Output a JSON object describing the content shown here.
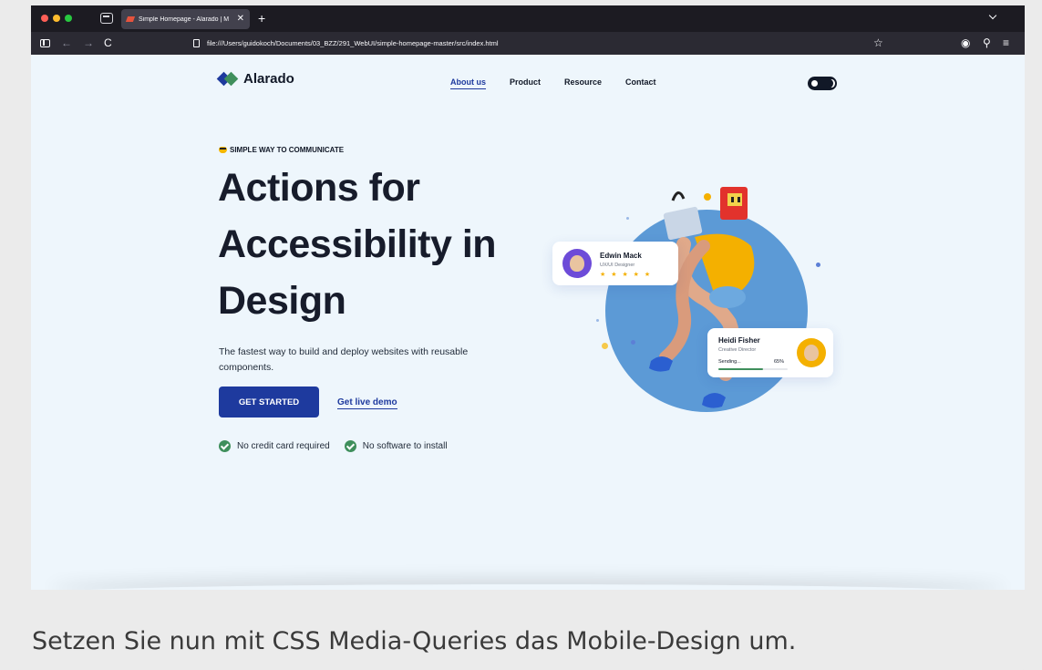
{
  "browser": {
    "tab_title": "Simple Homepage - Alarado | M",
    "tab_close": "✕",
    "new_tab": "+",
    "url": "file:///Users/guidokoch/Documents/03_BZZ/291_WebUI/simple-homepage-master/src/index.html",
    "icons": [
      "sidebar-icon",
      "back-icon",
      "forward-icon",
      "reload-icon",
      "bookmark-star-icon",
      "account-icon",
      "extensions-icon",
      "menu-icon"
    ],
    "back": "←",
    "forward": "→",
    "reload": "C",
    "star": "☆",
    "account": "◉",
    "extensions": "⚲",
    "menu": "≡"
  },
  "site": {
    "logo_text": "Alarado",
    "nav": [
      "About us",
      "Product",
      "Resource",
      "Contact"
    ],
    "active_nav": "About us",
    "eyebrow": "SIMPLE WAY TO COMMUNICATE",
    "headline": [
      "Actions for",
      "Accessibility in",
      "Design"
    ],
    "lead": "The fastest way to build and deploy websites with reusable components.",
    "cta": "GET STARTED",
    "demo_link": "Get live demo",
    "features": [
      "No credit card required",
      "No software to install"
    ],
    "cards": {
      "edwin": {
        "name": "Edwin Mack",
        "role": "UX/UI Designer",
        "stars": "★ ★ ★ ★ ★"
      },
      "heidi": {
        "name": "Heidi Fisher",
        "role": "Creative Director",
        "status": "Sending...",
        "percent": "65%",
        "progress": 0.65
      }
    },
    "colors": {
      "primary": "#1e3a9e",
      "accent_green": "#3f8f5c",
      "page_bg": "#eef6fc",
      "circle": "#5c9ad6"
    }
  },
  "caption": "Setzen Sie nun mit CSS Media-Queries das Mobile-Design um."
}
